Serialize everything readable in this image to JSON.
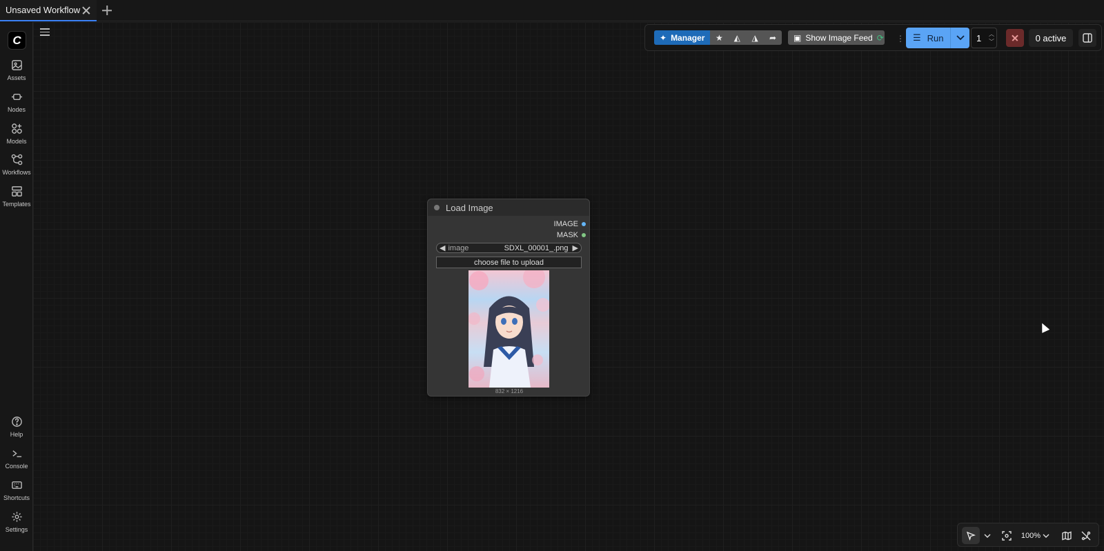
{
  "tabs": [
    {
      "label": "Unsaved Workflow"
    }
  ],
  "sidebar": {
    "logo": "C",
    "top_items": [
      {
        "label": "Assets",
        "icon": "image-icon"
      },
      {
        "label": "Nodes",
        "icon": "node-icon"
      },
      {
        "label": "Models",
        "icon": "models-icon"
      },
      {
        "label": "Workflows",
        "icon": "workflow-icon"
      },
      {
        "label": "Templates",
        "icon": "templates-icon"
      }
    ],
    "bottom_items": [
      {
        "label": "Help",
        "icon": "help-icon"
      },
      {
        "label": "Console",
        "icon": "terminal-icon"
      },
      {
        "label": "Shortcuts",
        "icon": "keyboard-icon"
      },
      {
        "label": "Settings",
        "icon": "gear-icon"
      }
    ]
  },
  "toolbar": {
    "manager_label": "Manager",
    "feed_label": "Show Image Feed",
    "run_label": "Run",
    "queue_count": "1",
    "active_label": "0 active"
  },
  "node": {
    "title": "Load Image",
    "outputs": [
      {
        "label": "IMAGE",
        "color": "#64b5f6"
      },
      {
        "label": "MASK",
        "color": "#81c784"
      }
    ],
    "widget_name": "image",
    "widget_value": "SDXL_00001_.png",
    "upload_label": "choose file to upload",
    "dimensions": "832 × 1216"
  },
  "canvas_controls": {
    "zoom": "100%"
  },
  "colors": {
    "accent": "#3b82f6",
    "manager": "#1e6bb8",
    "run": "#5aa4f5",
    "stop": "#6b2a2a"
  }
}
